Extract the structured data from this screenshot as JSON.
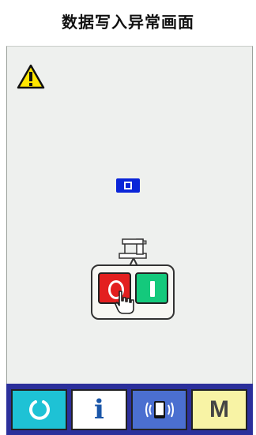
{
  "title": "数据写入异常画面",
  "bottom_bar": {
    "keys": [
      {
        "icon": "reset-icon",
        "color": "#1ec2d5"
      },
      {
        "icon": "information-icon",
        "label": "i",
        "color": "#ffffff"
      },
      {
        "icon": "communication-icon",
        "color": "#4b6fd0"
      },
      {
        "icon": "mode-icon",
        "label": "M",
        "color": "#f8f3a5"
      }
    ]
  },
  "icons": {
    "warning": "warning-icon",
    "media": "media-card-icon",
    "machine": "sewing-machine-icon",
    "stop_button": "red-stop-button-icon",
    "start_button": "green-start-button-icon",
    "hand": "pointing-hand-icon"
  },
  "colors": {
    "screen_bg": "#eef0ee",
    "bar_bg": "#2b2f9b",
    "warning_yellow": "#ffe600",
    "media_blue": "#0a25d8"
  }
}
